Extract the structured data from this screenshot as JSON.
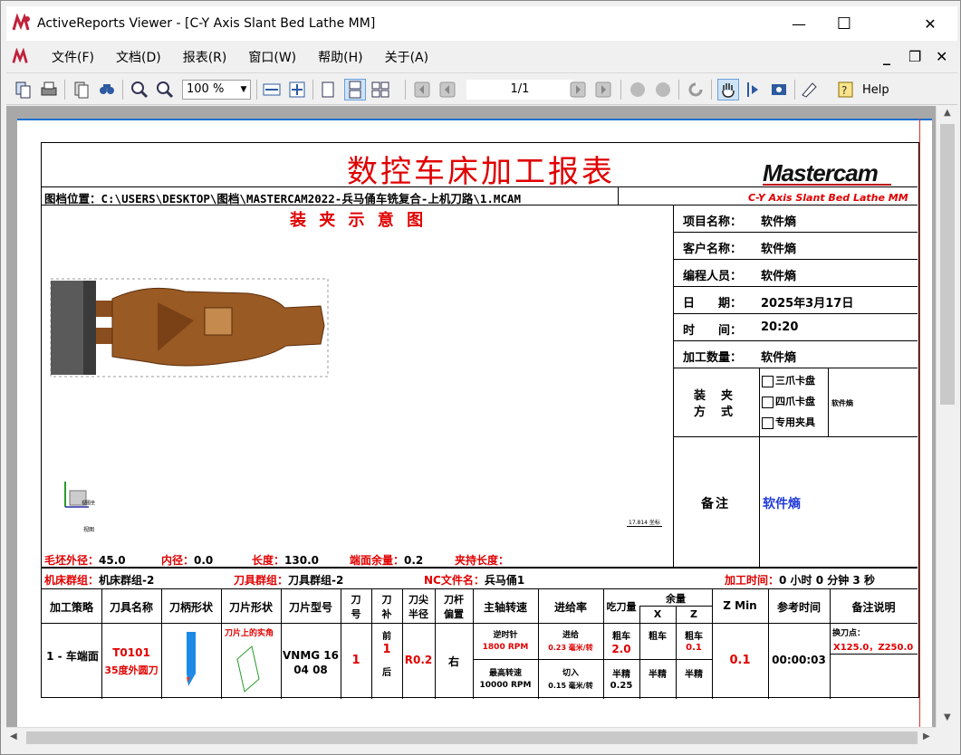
{
  "window": {
    "title": "ActiveReports Viewer - [C-Y Axis Slant Bed Lathe MM]",
    "minimize": "—",
    "maximize": "☐",
    "close": "✕"
  },
  "menu": {
    "items": [
      "文件(F)",
      "文档(D)",
      "报表(R)",
      "窗口(W)",
      "帮助(H)",
      "关于(A)"
    ]
  },
  "toolbar": {
    "zoom": "100 %",
    "page": "1/1",
    "help": "Help"
  },
  "report": {
    "title": "数控车床加工报表",
    "logo": "Mastercam",
    "machine_name": "C-Y Axis Slant Bed Lathe MM",
    "file_path": "图档位置：C:\\USERS\\DESKTOP\\图档\\MASTERCAM2022-兵马俑车铣复合-上机刀路\\1.MCAM",
    "setup_title": "装 夹 示 意 图",
    "info": [
      {
        "label": "项目名称：",
        "value": "软件熵"
      },
      {
        "label": "客户名称：",
        "value": "软件熵"
      },
      {
        "label": "编程人员：",
        "value": "软件熵"
      },
      {
        "label": "日　　期：",
        "value": "2025年3月17日"
      },
      {
        "label": "时　　间：",
        "value": "20:20"
      },
      {
        "label": "加工数量：",
        "value": "软件熵"
      }
    ],
    "clamp": {
      "label_top": "装　夹",
      "label_bottom": "方　式",
      "options": [
        "三爪卡盘",
        "四爪卡盘",
        "专用夹具"
      ],
      "value": "软件熵"
    },
    "notes": {
      "label": "备注",
      "value": "软件熵"
    },
    "preview": {
      "dim_label": "17.814 坐标",
      "axis_label": "视图坐",
      "mini_label": "视图"
    },
    "stock": {
      "od_label": "毛坯外径：",
      "od": "45.0",
      "id_label": "内径：",
      "id": "0.0",
      "len_label": "长度：",
      "len": "130.0",
      "face_label": "端面余量：",
      "face": "0.2",
      "chuck_label": "夹持长度：",
      "chuck": ""
    },
    "groups": {
      "machine_label": "机床群组：",
      "machine": "机床群组-2",
      "tool_label": "刀具群组：",
      "tool": "刀具群组-2",
      "nc_label": "NC文件名：",
      "nc": "兵马俑1",
      "time_label": "加工时间：",
      "time": "0 小时 0 分钟 3 秒"
    },
    "table": {
      "headers": [
        "加工策略",
        "刀具名称",
        "刀柄形状",
        "刀片形状",
        "刀片型号",
        "刀号",
        "刀补",
        "刀尖半径",
        "刀杆偏置",
        "主轴转速",
        "进给率",
        "吃刀量",
        "余量",
        "Z Min",
        "参考时间",
        "备注说明"
      ],
      "h_tool_no": [
        "刀",
        "号"
      ],
      "h_comp": [
        "刀",
        "补"
      ],
      "h_radius": [
        "刀尖",
        "半径"
      ],
      "h_offset": [
        "刀杆",
        "偏置"
      ],
      "sub_x": "X",
      "sub_z": "Z",
      "row": {
        "strategy": "1 - 车端面",
        "tool_name": "T0101",
        "tool_desc": "35度外圆刀",
        "insert_note": "刀片上的实角",
        "insert_model": "VNMG 16 04 08",
        "tool_no": "1",
        "comp_front": "前",
        "comp_val": "1",
        "comp_back": "后",
        "radius": "R0.2",
        "offset": "右",
        "spindle_l1": "逆时针",
        "spindle_l2": "1800 RPM",
        "spindle_l3": "最高转速",
        "spindle_l4": "10000 RPM",
        "feed_l1": "进给",
        "feed_l2": "0.23 毫米/转",
        "feed_l3": "切入",
        "feed_l4": "0.15 毫米/转",
        "doc_l1": "粗车",
        "doc_l2": "2.0",
        "doc_l3": "半精",
        "doc_l4": "0.25",
        "x_l1": "粗车",
        "x_l2": "半精",
        "z_l1": "粗车",
        "z_l2": "0.1",
        "z_l3": "半精",
        "zmin": "0.1",
        "ref_time": "00:00:03",
        "note_l1": "换刀点：",
        "note_l2": "X125.0，Z250.0"
      }
    }
  },
  "colors": {
    "accent": "#1e6fcf",
    "red": "#e00000",
    "blue": "#1f3ad8"
  }
}
